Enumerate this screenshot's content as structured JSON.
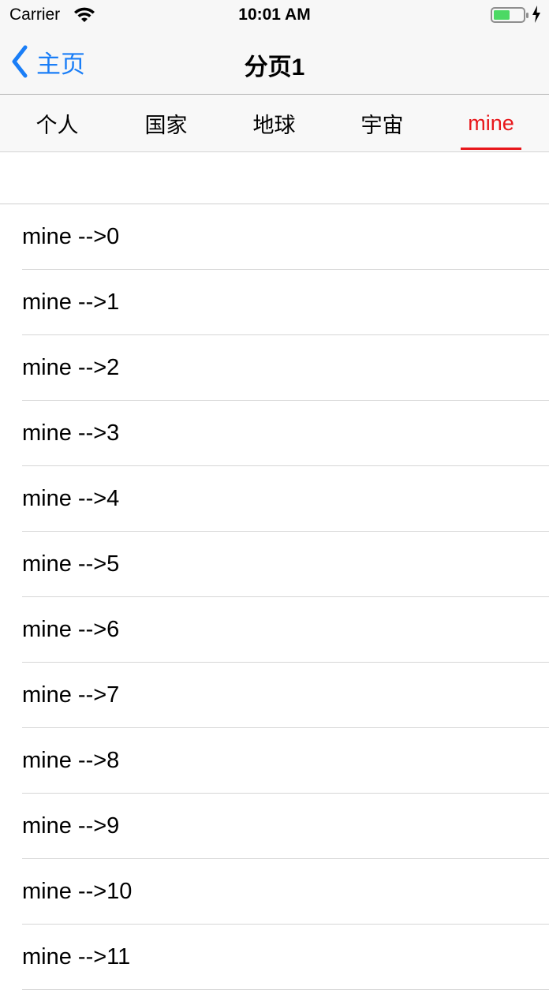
{
  "status_bar": {
    "carrier": "Carrier",
    "time": "10:01 AM",
    "battery_icon": "battery-charging-icon",
    "wifi_icon": "wifi-icon"
  },
  "nav": {
    "back_label": "主页",
    "title": "分页1",
    "accent_color": "#1a7ef7"
  },
  "tabs": [
    {
      "label": "个人"
    },
    {
      "label": "国家"
    },
    {
      "label": "地球"
    },
    {
      "label": "宇宙"
    },
    {
      "label": "mine",
      "active": true
    }
  ],
  "active_color": "#e8171b",
  "list": {
    "rows": [
      "mine -->0",
      "mine -->1",
      "mine -->2",
      "mine -->3",
      "mine -->4",
      "mine -->5",
      "mine -->6",
      "mine -->7",
      "mine -->8",
      "mine -->9",
      "mine -->10",
      "mine -->11"
    ]
  }
}
